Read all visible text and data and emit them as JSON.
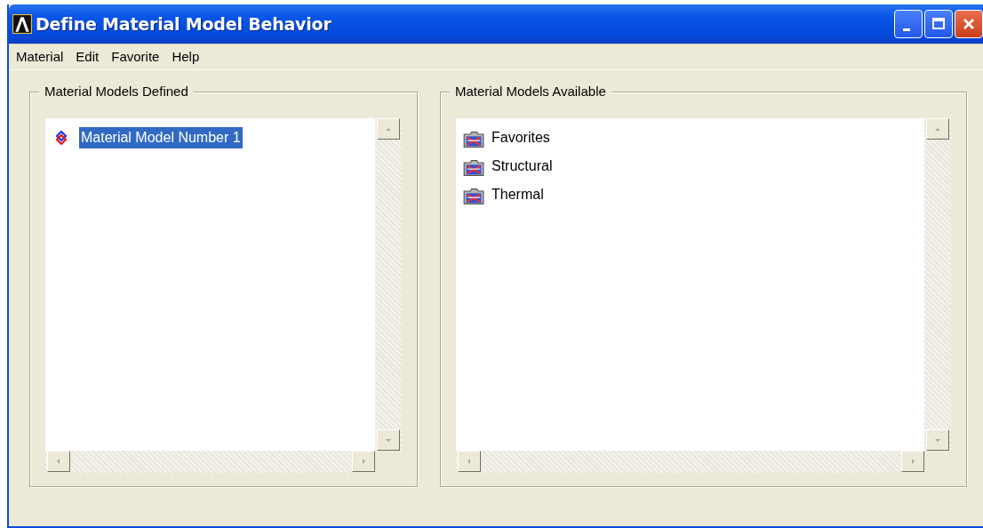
{
  "window": {
    "title": "Define Material Model Behavior"
  },
  "menu": [
    "Material",
    "Edit",
    "Favorite",
    "Help"
  ],
  "panels": [
    {
      "title": "Material Models Defined",
      "items": [
        {
          "label": "Material Model Number 1",
          "kind": "model",
          "selected": true
        }
      ]
    },
    {
      "title": "Material Models Available",
      "items": [
        {
          "label": "Favorites",
          "kind": "folder",
          "selected": false
        },
        {
          "label": "Structural",
          "kind": "folder",
          "selected": false
        },
        {
          "label": "Thermal",
          "kind": "folder",
          "selected": false
        }
      ]
    }
  ]
}
